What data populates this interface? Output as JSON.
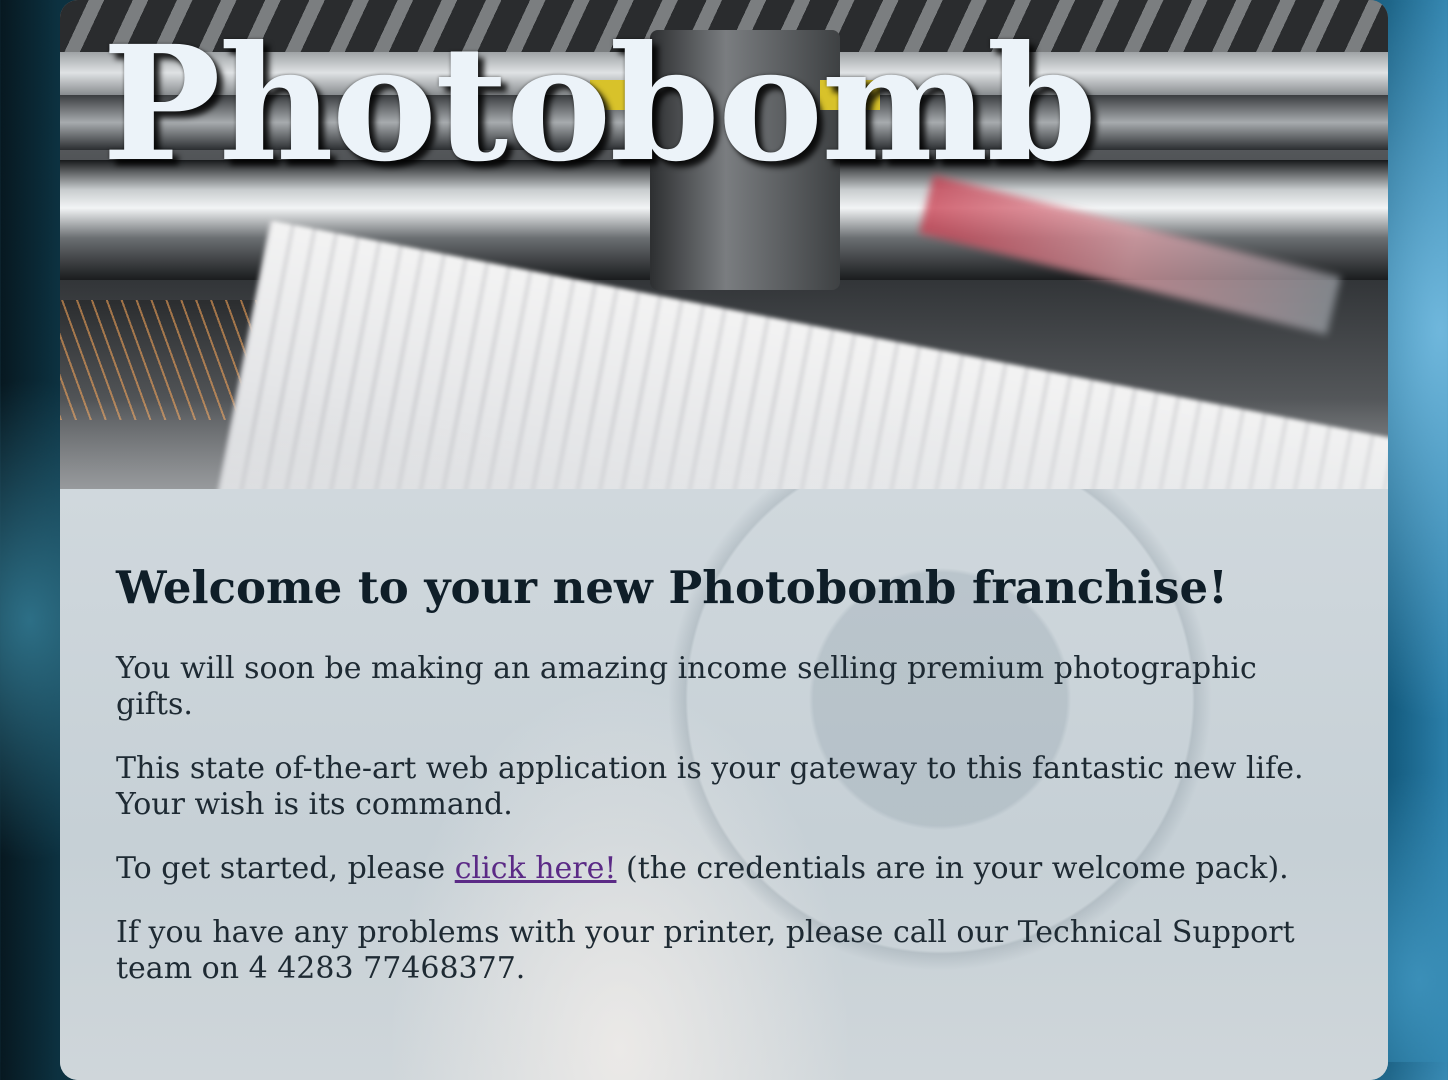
{
  "header": {
    "brand": "Photobomb",
    "image_icon": "printing-press-photo"
  },
  "main": {
    "heading": "Welcome to your new Photobomb franchise!",
    "paragraph_1": "You will soon be making an amazing income selling premium photographic gifts.",
    "paragraph_2": "This state of-the-art web application is your gateway to this fantastic new life. Your wish is its command.",
    "paragraph_3_before": "To get started, please ",
    "paragraph_3_link": "click here!",
    "paragraph_3_after": " (the credentials are in your welcome pack).",
    "paragraph_4": "If you have any problems with your printer, please call our Technical Support team on 4 4283 77468377."
  },
  "colors": {
    "link": "#5b2a86",
    "heading": "#0f1e28",
    "brand_text": "#ecf3f9"
  }
}
